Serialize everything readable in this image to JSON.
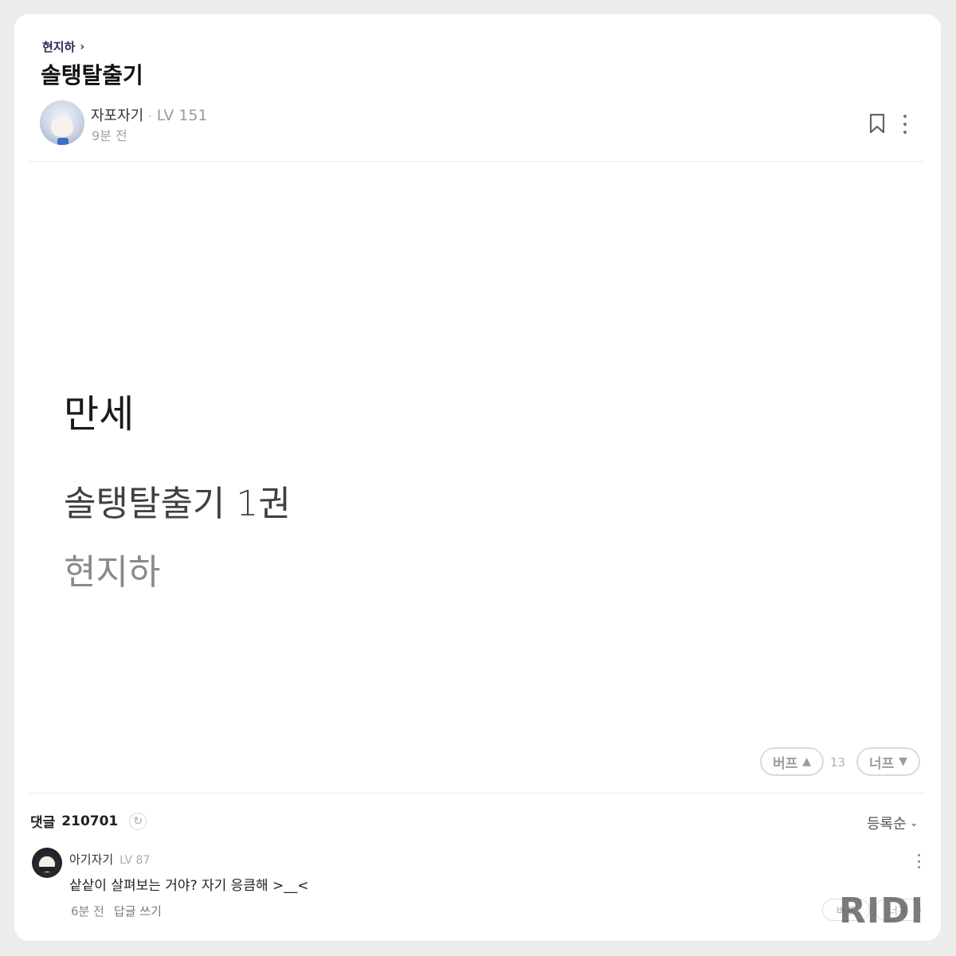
{
  "breadcrumb": {
    "author": "현지하",
    "chevron_icon": "chevron-right-icon"
  },
  "post": {
    "title": "솔탱탈출기",
    "author_name": "자포자기",
    "separator": "·",
    "level": "LV 151",
    "time": "9분 전"
  },
  "content": {
    "line1": "만세",
    "line2": "솔탱탈출기 1권",
    "line3": "현지하"
  },
  "reactions": {
    "buff_label": "버프",
    "buff_arrow": "▲",
    "count": "13",
    "nerf_label": "너프",
    "nerf_arrow": "▼"
  },
  "comments": {
    "header_label": "댓글",
    "count": "210701",
    "refresh_glyph": "↻",
    "sort_label": "등록순",
    "sort_chevron": "⌄",
    "items": [
      {
        "author": "아기자기",
        "level": "LV 87",
        "text": "샅샅이 살펴보는 거야? 자기 응큼해 >__<",
        "time": "6분 전",
        "reply_label": "답글 쓰기",
        "buff_label": "버프",
        "nerf_label": "너프"
      }
    ]
  },
  "watermark": "RIDI",
  "colors": {
    "background": "#ececed",
    "card": "#ffffff",
    "breadcrumb": "#2c2a56",
    "muted": "#a2a2a2"
  }
}
